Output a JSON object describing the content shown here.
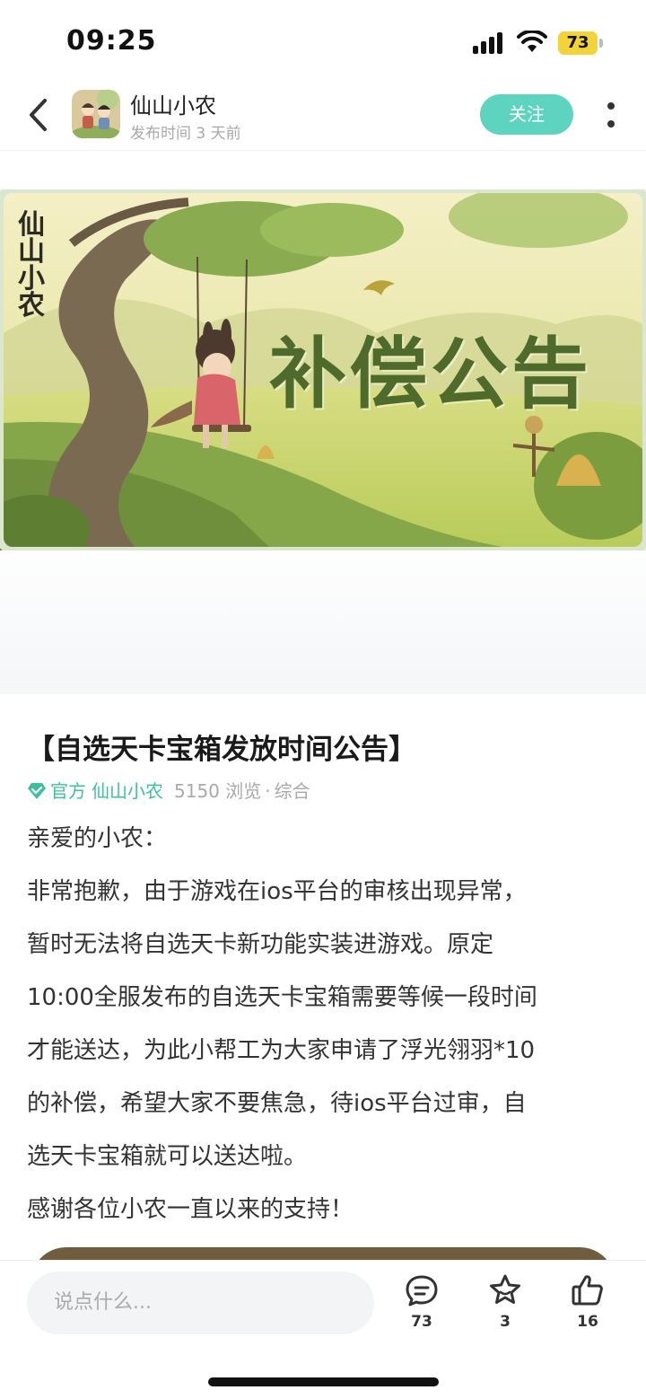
{
  "status_bar": {
    "time": "09:25",
    "battery": "73"
  },
  "header": {
    "author_name": "仙山小农",
    "post_time": "发布时间 3 天前",
    "follow_label": "关注"
  },
  "banner": {
    "title_text": "补偿公告",
    "logo_text": "仙山小农"
  },
  "article": {
    "title": "【自选天卡宝箱发放时间公告】",
    "official_label": "官方",
    "author": "仙山小农",
    "views": "5150 浏览",
    "dot": "·",
    "category": "综合",
    "lines": [
      "亲爱的小农：",
      "非常抱歉，由于游戏在ios平台的审核出现异常，",
      "暂时无法将自选天卡新功能实装进游戏。原定",
      "10:00全服发布的自选天卡宝箱需要等候一段时间",
      "才能送达，为此小帮工为大家申请了浮光翎羽*10",
      "的补偿，希望大家不要焦急，待ios平台过审，自",
      "选天卡宝箱就可以送达啦。",
      "感谢各位小农一直以来的支持！"
    ]
  },
  "bottom_bar": {
    "comment_placeholder": "说点什么...",
    "comment_count": "73",
    "favorite_count": "3",
    "like_count": "16"
  },
  "colors": {
    "accent": "#5ed3bf",
    "official": "#3fbf9f",
    "banner_title": "#4f6b2c"
  },
  "icons": [
    "back-icon",
    "more-icon",
    "official-verified-icon",
    "comment-icon",
    "star-icon",
    "thumbs-up-icon"
  ]
}
